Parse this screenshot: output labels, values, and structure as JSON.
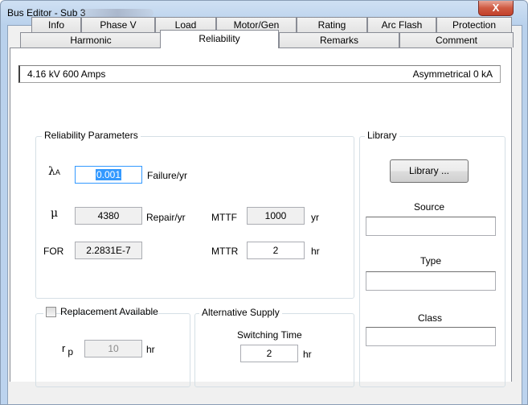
{
  "window": {
    "title": "Bus Editor - Sub 3",
    "close_label": "X"
  },
  "tabs": {
    "row1": [
      "Info",
      "Phase V",
      "Load",
      "Motor/Gen",
      "Rating",
      "Arc Flash",
      "Protection"
    ],
    "row2": [
      "Harmonic",
      "Reliability",
      "Remarks",
      "Comment"
    ],
    "active": "Reliability"
  },
  "info_bar": {
    "left": "4.16 kV  600 Amps",
    "right": "Asymmetrical 0 kA"
  },
  "reliability": {
    "group_title": "Reliability Parameters",
    "lambda_symbol": "λ",
    "lambda_subscript": "A",
    "lambda_value": "0.001",
    "lambda_unit": "Failure/yr",
    "mu_symbol": "μ",
    "mu_value": "4380",
    "mu_unit": "Repair/yr",
    "mttf_label": "MTTF",
    "mttf_value": "1000",
    "mttf_unit": "yr",
    "for_label": "FOR",
    "for_value": "2.2831E-7",
    "mttr_label": "MTTR",
    "mttr_value": "2",
    "mttr_unit": "hr"
  },
  "replacement": {
    "label": "Replacement Available",
    "checked": false,
    "rp_symbol": "r",
    "rp_subscript": "p",
    "rp_value": "10",
    "rp_unit": "hr"
  },
  "alternative_supply": {
    "group_title": "Alternative Supply",
    "switching_label": "Switching Time",
    "switching_value": "2",
    "switching_unit": "hr"
  },
  "library": {
    "group_title": "Library",
    "button_label": "Library ...",
    "source_label": "Source",
    "source_value": "",
    "type_label": "Type",
    "type_value": "",
    "class_label": "Class",
    "class_value": ""
  },
  "colors": {
    "selection": "#3399ff",
    "close_button": "#c7432c"
  }
}
